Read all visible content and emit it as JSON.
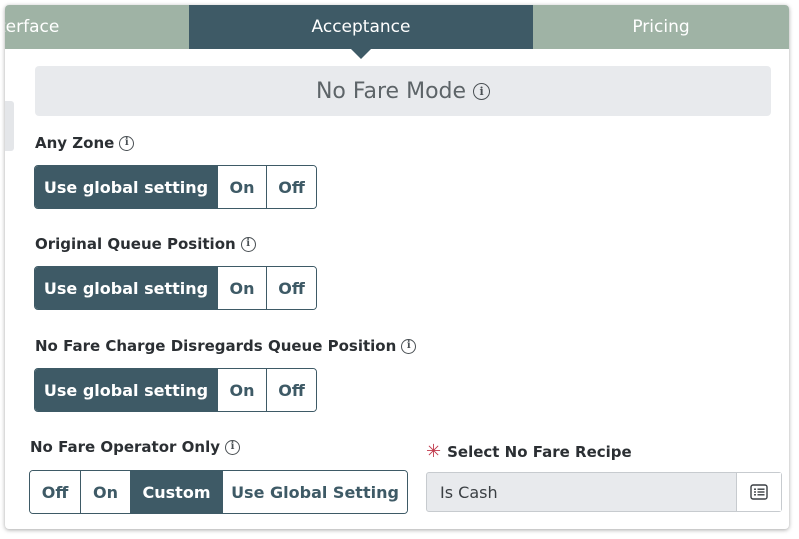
{
  "tabs": [
    {
      "label": "terface"
    },
    {
      "label": "Acceptance"
    },
    {
      "label": "Pricing"
    }
  ],
  "banner": {
    "label": "No Fare Mode"
  },
  "settings": [
    {
      "label": "Any Zone",
      "options": [
        "Use global setting",
        "On",
        "Off"
      ],
      "selected": "Use global setting"
    },
    {
      "label": "Original Queue Position",
      "options": [
        "Use global setting",
        "On",
        "Off"
      ],
      "selected": "Use global setting"
    },
    {
      "label": "No Fare Charge Disregards Queue Position",
      "options": [
        "Use global setting",
        "On",
        "Off"
      ],
      "selected": "Use global setting"
    }
  ],
  "operator_only": {
    "label": "No Fare Operator Only",
    "options": [
      "Off",
      "On",
      "Custom",
      "Use Global Setting"
    ],
    "selected": "Custom"
  },
  "recipe": {
    "required_mark": "✳",
    "label": "Select No Fare Recipe",
    "value": "Is Cash"
  },
  "colors": {
    "accent": "#3e5a66",
    "tab_inactive": "#9fb3a5",
    "required": "#c0394b"
  },
  "icons": {
    "info": "info-icon",
    "list": "list-icon"
  }
}
